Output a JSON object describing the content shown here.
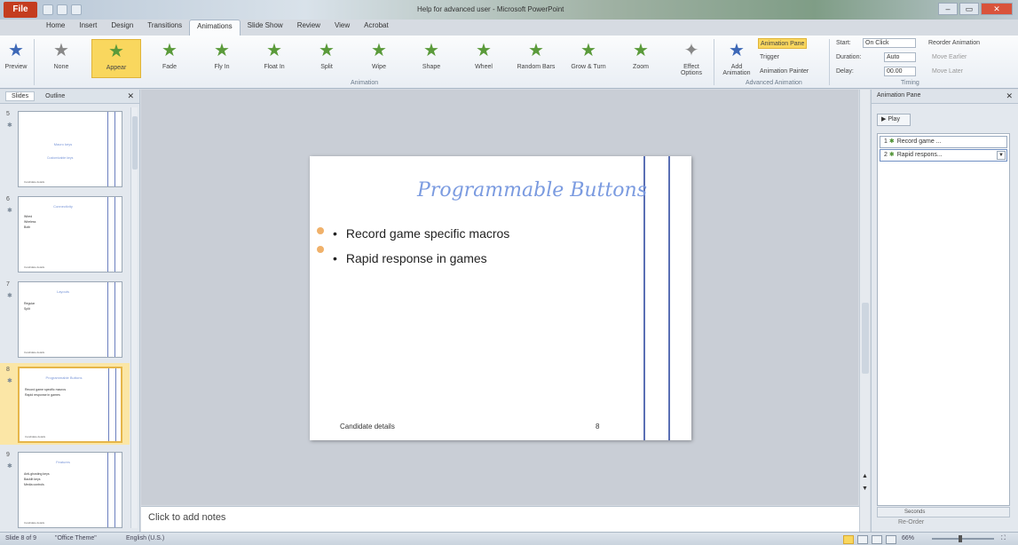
{
  "app": {
    "menu_label": "File",
    "title": "Help for advanced user - Microsoft PowerPoint",
    "window_controls": [
      "–",
      "▭",
      "✕"
    ]
  },
  "tabs": [
    "Home",
    "Insert",
    "Design",
    "Transitions",
    "Animations",
    "Slide Show",
    "Review",
    "View",
    "Acrobat"
  ],
  "active_tab": "Animations",
  "ribbon": {
    "preview_label": "Preview",
    "effects": [
      "None",
      "Appear",
      "Fade",
      "Fly In",
      "Float In",
      "Split",
      "Wipe",
      "Shape",
      "Wheel",
      "Random Bars",
      "Grow & Turn",
      "Zoom"
    ],
    "selected_effect": "Appear",
    "effect_options_label": "Effect Options",
    "add_animation_label": "Add Animation",
    "animation_pane_label": "Animation Pane",
    "trigger_label": "Trigger",
    "animation_painter_label": "Animation Painter",
    "start_label": "Start:",
    "start_value": "On Click",
    "duration_label": "Duration:",
    "duration_value": "Auto",
    "delay_label": "Delay:",
    "delay_value": "00.00",
    "reorder_label": "Reorder Animation",
    "move_earlier": "Move Earlier",
    "move_later": "Move Later",
    "group_animation": "Animation",
    "group_advanced": "Advanced Animation",
    "group_timing": "Timing"
  },
  "left_pane": {
    "tab_slides": "Slides",
    "tab_outline": "Outline",
    "close": "✕",
    "slides": [
      {
        "num": "5",
        "title": "Macro keys",
        "bullets": [
          "Customizable keys"
        ],
        "footer": "Candidate details"
      },
      {
        "num": "6",
        "title": "Connectivity",
        "bullets": [
          "Wired",
          "Wireless",
          "Both"
        ],
        "footer": "Candidate details"
      },
      {
        "num": "7",
        "title": "Layouts",
        "bullets": [
          "Regular",
          "Split"
        ],
        "footer": "Candidate details"
      },
      {
        "num": "8",
        "title": "Programmable Buttons",
        "bullets": [
          "Record game specific macros",
          "Rapid response in games"
        ],
        "footer": "Candidate details",
        "current": true
      },
      {
        "num": "9",
        "title": "Features",
        "bullets": [
          "Anti-ghosting keys",
          "Backlit keys",
          "Media controls"
        ],
        "footer": "Candidate details"
      }
    ]
  },
  "slide": {
    "title": "Programmable Buttons",
    "bullets": [
      "Record game specific macros",
      "Rapid response in games"
    ],
    "footer": "Candidate details",
    "page_number": "8"
  },
  "notes_placeholder": "Click to add notes",
  "animation_pane": {
    "title": "Animation Pane",
    "play_label": "Play",
    "items": [
      {
        "index": "1",
        "label": "Record game ..."
      },
      {
        "index": "2",
        "label": "Rapid respons..."
      }
    ],
    "timeline_label": "Seconds",
    "reorder_label": "Re-Order"
  },
  "status": {
    "slide_info": "Slide 8 of 9",
    "theme": "\"Office Theme\"",
    "language": "English (U.S.)",
    "zoom": "66%"
  },
  "colors": {
    "title_accent": "#7b9be0",
    "selection": "#f9d75e",
    "app_button": "#c43c1f"
  }
}
